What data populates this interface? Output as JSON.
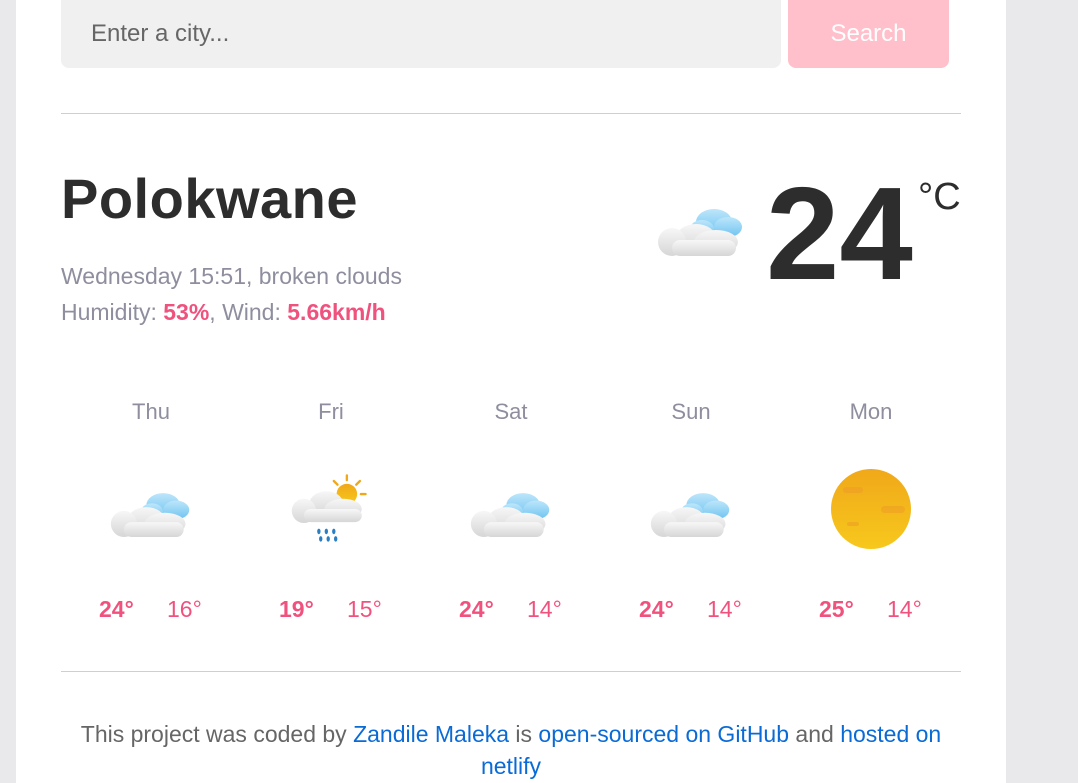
{
  "search": {
    "placeholder": "Enter a city...",
    "button_label": "Search"
  },
  "current": {
    "city": "Polokwane",
    "datetime_desc": "Wednesday 15:51, broken clouds",
    "humidity_label": "Humidity: ",
    "humidity_value": "53%",
    "wind_label": ", Wind: ",
    "wind_value": "5.66km/h",
    "temperature": "24",
    "unit": "°C",
    "icon": "broken-clouds-icon"
  },
  "forecast": [
    {
      "day": "Thu",
      "high": "24°",
      "low": "16°",
      "icon": "broken-clouds-icon"
    },
    {
      "day": "Fri",
      "high": "19°",
      "low": "15°",
      "icon": "rain-sun-icon"
    },
    {
      "day": "Sat",
      "high": "24°",
      "low": "14°",
      "icon": "broken-clouds-icon"
    },
    {
      "day": "Sun",
      "high": "24°",
      "low": "14°",
      "icon": "broken-clouds-icon"
    },
    {
      "day": "Mon",
      "high": "25°",
      "low": "14°",
      "icon": "sun-icon"
    }
  ],
  "footer": {
    "prefix": "This project was coded by ",
    "author_link": "Zandile Maleka",
    "mid1": " is ",
    "github_link": "open-sourced on GitHub",
    "mid2": " and ",
    "hosted_link": "hosted on netlify"
  },
  "colors": {
    "accent": "#f0527e",
    "link": "#0a6bd6",
    "button": "#ffc0cb"
  }
}
